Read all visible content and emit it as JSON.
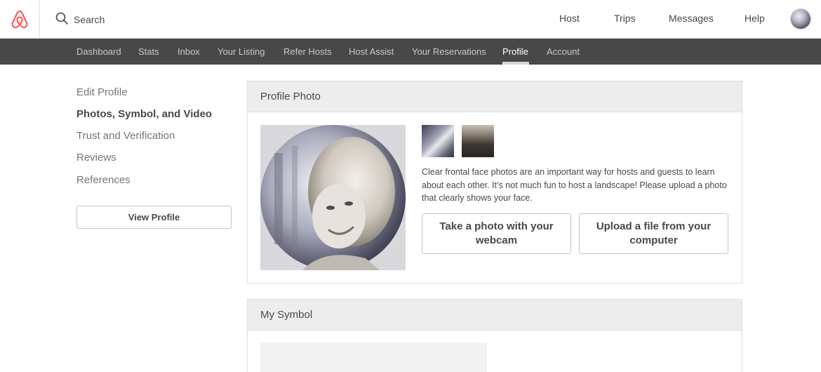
{
  "header": {
    "logo_icon": "airbnb-belo-icon",
    "brand_color": "#FF5A5F",
    "search": {
      "icon": "search-icon",
      "placeholder": "Search"
    },
    "nav": [
      {
        "label": "Host"
      },
      {
        "label": "Trips"
      },
      {
        "label": "Messages"
      },
      {
        "label": "Help"
      }
    ],
    "avatar_icon": "user-avatar"
  },
  "subnav": {
    "items": [
      {
        "label": "Dashboard"
      },
      {
        "label": "Stats"
      },
      {
        "label": "Inbox"
      },
      {
        "label": "Your Listing"
      },
      {
        "label": "Refer Hosts"
      },
      {
        "label": "Host Assist"
      },
      {
        "label": "Your Reservations"
      },
      {
        "label": "Profile"
      },
      {
        "label": "Account"
      }
    ],
    "active": "Profile"
  },
  "sidebar": {
    "items": [
      {
        "label": "Edit Profile"
      },
      {
        "label": "Photos, Symbol, and Video"
      },
      {
        "label": "Trust and Verification"
      },
      {
        "label": "Reviews"
      },
      {
        "label": "References"
      }
    ],
    "active": "Photos, Symbol, and Video",
    "view_profile_label": "View Profile"
  },
  "profile_photo": {
    "title": "Profile Photo",
    "description": "Clear frontal face photos are an important way for hosts and guests to learn about each other. It’s not much fun to host a landscape! Please upload a photo that clearly shows your face.",
    "webcam_label": "Take a photo with your webcam",
    "upload_label": "Upload a file from your computer"
  },
  "my_symbol": {
    "title": "My Symbol"
  }
}
